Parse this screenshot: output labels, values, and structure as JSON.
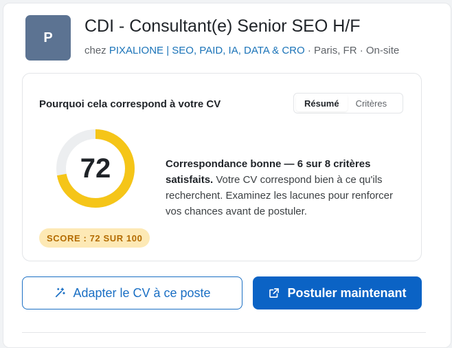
{
  "header": {
    "avatar_letter": "P",
    "job_title": "CDI - Consultant(e) Senior SEO H/F",
    "at_prefix": "chez",
    "company": "PIXALIONE | SEO, PAID, IA, DATA & CRO",
    "separator": "·",
    "location": "Paris, FR",
    "work_mode": "On-site"
  },
  "match": {
    "title": "Pourquoi cela correspond à votre CV",
    "tabs": [
      {
        "label": "Résumé",
        "active": true
      },
      {
        "label": "Critères",
        "active": false
      }
    ],
    "score": 72,
    "score_max": 100,
    "score_display": "72",
    "score_badge": "SCORE : 72 SUR 100",
    "summary_bold": "Correspondance bonne — 6 sur 8 critères satisfaits.",
    "summary_text": " Votre CV correspond bien à ce qu'ils recherchent. Examinez les lacunes pour renforcer vos chances avant de postuler."
  },
  "actions": {
    "adapt_label": "Adapter le CV à ce poste",
    "apply_label": "Postuler maintenant",
    "adapt_icon": "magic-wand-icon",
    "apply_icon": "external-link-icon"
  },
  "colors": {
    "accent": "#0b63c5",
    "gauge_fill": "#f5c518",
    "gauge_track": "#eceef0",
    "badge_bg": "#fde9b5",
    "badge_text": "#b36b00",
    "avatar_bg": "#5c7392"
  }
}
